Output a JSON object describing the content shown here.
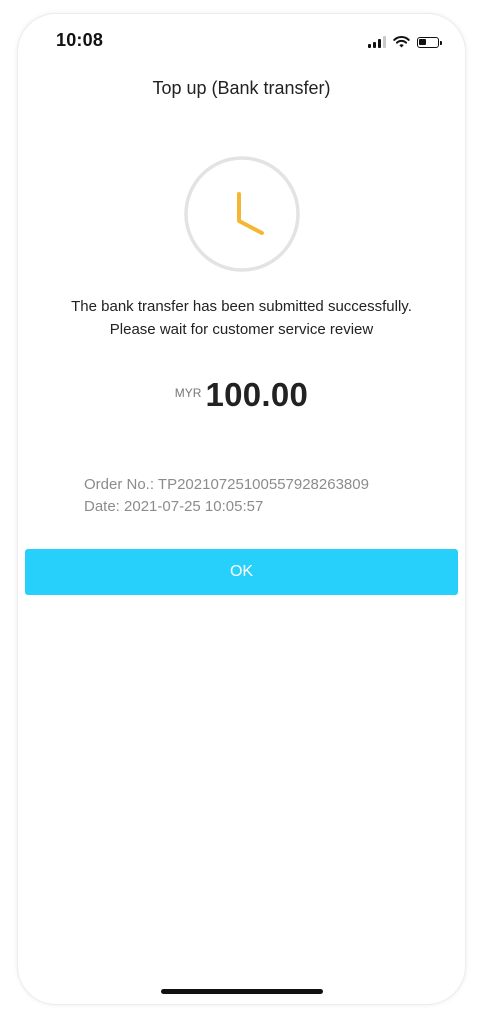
{
  "status_bar": {
    "time": "10:08",
    "battery_level": 0.4
  },
  "header": {
    "title": "Top up (Bank transfer)"
  },
  "status_icon": {
    "name": "clock-icon",
    "hand_color": "#f5b731",
    "ring_color": "#e3e3e3"
  },
  "message": {
    "line1": "The bank transfer has been submitted successfully.",
    "line2": "Please wait for customer service review"
  },
  "amount": {
    "currency": "MYR",
    "value": "100.00"
  },
  "order": {
    "order_no": "Order No.: TP20210725100557928263809",
    "date": "Date: 2021-07-25 10:05:57"
  },
  "actions": {
    "ok_label": "OK",
    "ok_color": "#26d0fb"
  }
}
